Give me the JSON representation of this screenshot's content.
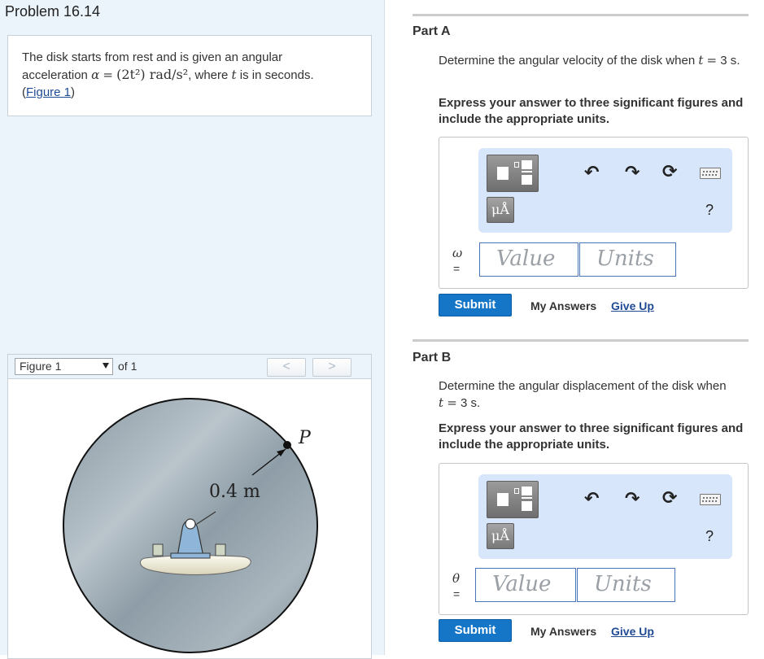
{
  "problem": {
    "title": "Problem 16.14",
    "text_line1": "The disk starts from rest and is given an angular",
    "text_acc_prefix": "acceleration",
    "alpha": "α",
    "eq": "=",
    "expr": "(2t²) rad/s²",
    "text_acc_suffix": ", where",
    "t": "t",
    "text_end": "is in seconds.",
    "figure_link": "Figure 1",
    "paren_open": "(",
    "paren_close": ")"
  },
  "figure_panel": {
    "select_value": "Figure 1",
    "of_label": "of 1",
    "prev_glyph": "<",
    "next_glyph": ">",
    "label_length": "0.4 m",
    "label_point": "P",
    "colors": {
      "disk": "#9aa9b3",
      "pin": "#8fb6d9",
      "support": "#f3f0dc"
    }
  },
  "parts": [
    {
      "title": "Part A",
      "question_a": "Determine the angular velocity of the disk when",
      "question_var": "t",
      "question_eq": "=",
      "question_b": "3 s",
      "question_end": ".",
      "instruction": "Express your answer to three significant figures and include the appropriate units.",
      "variable": "ω",
      "equals": "=",
      "value_placeholder": "Value",
      "units_placeholder": "Units",
      "mu_label": "μÅ",
      "help_label": "?",
      "submit": "Submit",
      "my_answers": "My Answers",
      "give_up": "Give Up"
    },
    {
      "title": "Part B",
      "question_a": "Determine the angular displacement of the disk when",
      "question_var": "t",
      "question_eq": "=",
      "question_b": "3 s",
      "question_end": ".",
      "instruction": "Express your answer to three significant figures and include the appropriate units.",
      "variable": "θ",
      "equals": "=",
      "value_placeholder": "Value",
      "units_placeholder": "Units",
      "mu_label": "μÅ",
      "help_label": "?",
      "submit": "Submit",
      "my_answers": "My Answers",
      "give_up": "Give Up"
    }
  ],
  "colors": {
    "accent": "#1576c7",
    "link": "#1f4a94",
    "toolbar": "#d7e6fb",
    "left_panel": "#ebf3fb"
  },
  "icons": [
    "templates-icon",
    "undo-icon",
    "redo-icon",
    "reset-icon",
    "keyboard-icon",
    "help-icon",
    "dropdown-caret-icon"
  ]
}
